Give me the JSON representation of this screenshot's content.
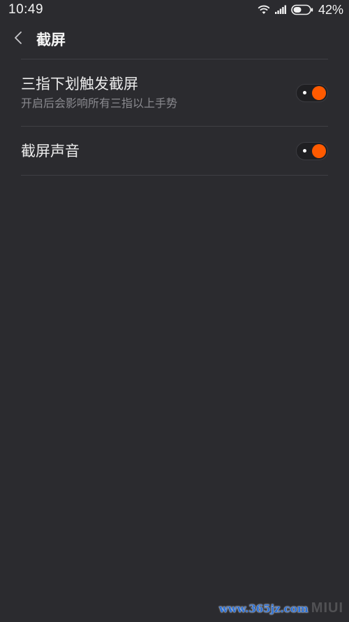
{
  "status_bar": {
    "time": "10:49",
    "battery_percent": "42%",
    "icons": [
      "wifi-icon",
      "signal-icon",
      "battery-icon"
    ]
  },
  "header": {
    "back_icon": "chevron-left-icon",
    "title": "截屏"
  },
  "settings": [
    {
      "title": "三指下划触发截屏",
      "subtitle": "开启后会影响所有三指以上手势",
      "enabled": true
    },
    {
      "title": "截屏声音",
      "enabled": true
    }
  ],
  "watermark": {
    "site": "www.365jz.com",
    "brand": "MIUI"
  },
  "colors": {
    "background": "#2b2b2f",
    "toggle_on": "#ff5a00",
    "divider": "#3f3f44",
    "subtitle_text": "#8a8a8f"
  }
}
